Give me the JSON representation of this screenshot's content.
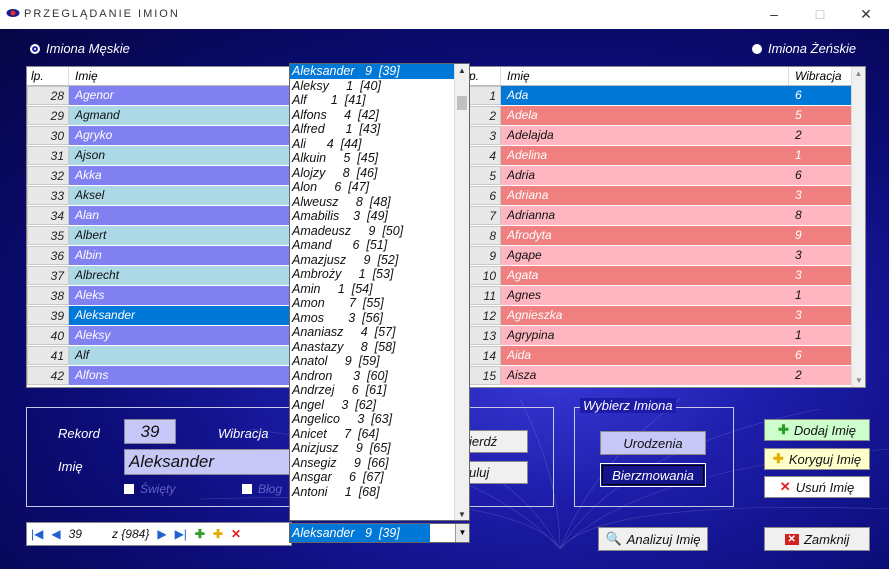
{
  "window": {
    "title": "PRZEGLĄDANIE IMION",
    "minimize": "–",
    "maximize": "□",
    "close": "✕"
  },
  "radios": {
    "male": "Imiona Męskie",
    "female": "Imiona Żeńskie"
  },
  "male_grid": {
    "headers": [
      "lp.",
      "Imię"
    ],
    "rows": [
      {
        "lp": "28",
        "name": "Agenor",
        "style": "blue"
      },
      {
        "lp": "29",
        "name": "Agmand",
        "style": "cyan"
      },
      {
        "lp": "30",
        "name": "Agryko",
        "style": "blue"
      },
      {
        "lp": "31",
        "name": "Ajson",
        "style": "cyan"
      },
      {
        "lp": "32",
        "name": "Akka",
        "style": "blue"
      },
      {
        "lp": "33",
        "name": "Aksel",
        "style": "cyan"
      },
      {
        "lp": "34",
        "name": "Alan",
        "style": "blue"
      },
      {
        "lp": "35",
        "name": "Albert",
        "style": "cyan"
      },
      {
        "lp": "36",
        "name": "Albin",
        "style": "blue"
      },
      {
        "lp": "37",
        "name": "Albrecht",
        "style": "cyan"
      },
      {
        "lp": "38",
        "name": "Aleks",
        "style": "blue"
      },
      {
        "lp": "39",
        "name": "Aleksander",
        "style": "sel"
      },
      {
        "lp": "40",
        "name": "Aleksy",
        "style": "blue"
      },
      {
        "lp": "41",
        "name": "Alf",
        "style": "cyan"
      },
      {
        "lp": "42",
        "name": "Alfons",
        "style": "blue"
      }
    ]
  },
  "female_grid": {
    "headers": [
      "p.",
      "Imię",
      "Wibracja"
    ],
    "rows": [
      {
        "lp": "1",
        "name": "Ada",
        "vib": "6",
        "style": "sel"
      },
      {
        "lp": "2",
        "name": "Adela",
        "vib": "5",
        "style": "red"
      },
      {
        "lp": "3",
        "name": "Adelajda",
        "vib": "2",
        "style": "pink"
      },
      {
        "lp": "4",
        "name": "Adelina",
        "vib": "1",
        "style": "red"
      },
      {
        "lp": "5",
        "name": "Adria",
        "vib": "6",
        "style": "pink"
      },
      {
        "lp": "6",
        "name": "Adriana",
        "vib": "3",
        "style": "red"
      },
      {
        "lp": "7",
        "name": "Adrianna",
        "vib": "8",
        "style": "pink"
      },
      {
        "lp": "8",
        "name": "Afrodyta",
        "vib": "9",
        "style": "red"
      },
      {
        "lp": "9",
        "name": "Agape",
        "vib": "3",
        "style": "pink"
      },
      {
        "lp": "10",
        "name": "Agata",
        "vib": "3",
        "style": "red"
      },
      {
        "lp": "11",
        "name": "Agnes",
        "vib": "1",
        "style": "pink"
      },
      {
        "lp": "12",
        "name": "Agnieszka",
        "vib": "3",
        "style": "red"
      },
      {
        "lp": "13",
        "name": "Agrypina",
        "vib": "1",
        "style": "pink"
      },
      {
        "lp": "14",
        "name": "Aida",
        "vib": "6",
        "style": "red"
      },
      {
        "lp": "15",
        "name": "Aisza",
        "vib": "2",
        "style": "pink"
      }
    ]
  },
  "dropdown": [
    "Aleksander   9  [39]",
    "Aleksy     1  [40]",
    "Alf       1  [41]",
    "Alfons     4  [42]",
    "Alfred      1  [43]",
    "Ali      4  [44]",
    "Alkuin     5  [45]",
    "Alojzy     8  [46]",
    "Alon     6  [47]",
    "Alweusz     8  [48]",
    "Amabilis    3  [49]",
    "Amadeusz     9  [50]",
    "Amand      6  [51]",
    "Amazjusz     9  [52]",
    "Ambroży     1  [53]",
    "Amin     1  [54]",
    "Amon       7  [55]",
    "Amos       3  [56]",
    "Ananiasz     4  [57]",
    "Anastazy     8  [58]",
    "Anatol     9  [59]",
    "Andron      3  [60]",
    "Andrzej     6  [61]",
    "Angel     3  [62]",
    "Angelico     3  [63]",
    "Anicet     7  [64]",
    "Anizjusz     9  [65]",
    "Ansegiz     9  [66]",
    "Ansgar     6  [67]",
    "Antoni     1  [68]"
  ],
  "combo_value": "Aleksander   9  [39]",
  "record_panel": {
    "rekord_label": "Rekord",
    "rekord_value": "39",
    "wibracja_label": "Wibracja",
    "imie_label": "Imię",
    "imie_value": "Aleksander",
    "swiety_label": "Święty",
    "blog_label": "Błog"
  },
  "action_buttons": {
    "zatwierdz": "ierdź",
    "anuluj": "uluj"
  },
  "wybierz": {
    "title": "Wybierz Imiona",
    "urodzenia": "Urodzenia",
    "bierzmowania": "Bierzmowania"
  },
  "right_buttons": {
    "dodaj": "Dodaj Imię",
    "koryguj": "Koryguj Imię",
    "usun": "Usuń Imię"
  },
  "navigator": {
    "current": "39",
    "total": "z {984}"
  },
  "bottom_buttons": {
    "analizuj": "Analizuj Imię",
    "zamknij": "Zamknij"
  },
  "colors": {
    "background": "#1c1ca8",
    "selection": "#0078d7",
    "male_row": "#8080f0",
    "male_alt": "#add8e6",
    "female_row": "#f08080",
    "female_alt": "#ffb6c1"
  }
}
